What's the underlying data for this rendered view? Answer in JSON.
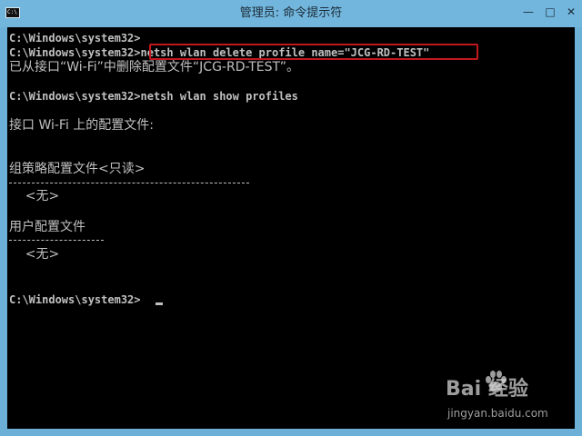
{
  "window": {
    "title": "管理员: 命令提示符",
    "icon_text": "C:\\",
    "controls": {
      "minimize": "—",
      "maximize": "□",
      "close": "✕"
    }
  },
  "console": {
    "lines": [
      "C:\\Windows\\system32>",
      "C:\\Windows\\system32>netsh wlan delete profile name=\"JCG-RD-TEST\"",
      "已从接口“Wi-Fi”中删除配置文件“JCG-RD-TEST”。",
      "",
      "C:\\Windows\\system32>netsh wlan show profiles",
      "",
      "接口 Wi-Fi 上的配置文件:",
      "",
      "",
      "组策略配置文件<只读>",
      "",
      "    <无>",
      "",
      "用户配置文件",
      "",
      "    <无>",
      "",
      "",
      "C:\\Windows\\system32>"
    ]
  },
  "colors": {
    "console_bg": "#000000",
    "console_text": "#c0c0c0",
    "titlebar": "#72b6dd",
    "highlight": "#c0181c"
  },
  "watermark": {
    "brand": "Bai  经验",
    "sub": "jingyan.baidu.com"
  }
}
